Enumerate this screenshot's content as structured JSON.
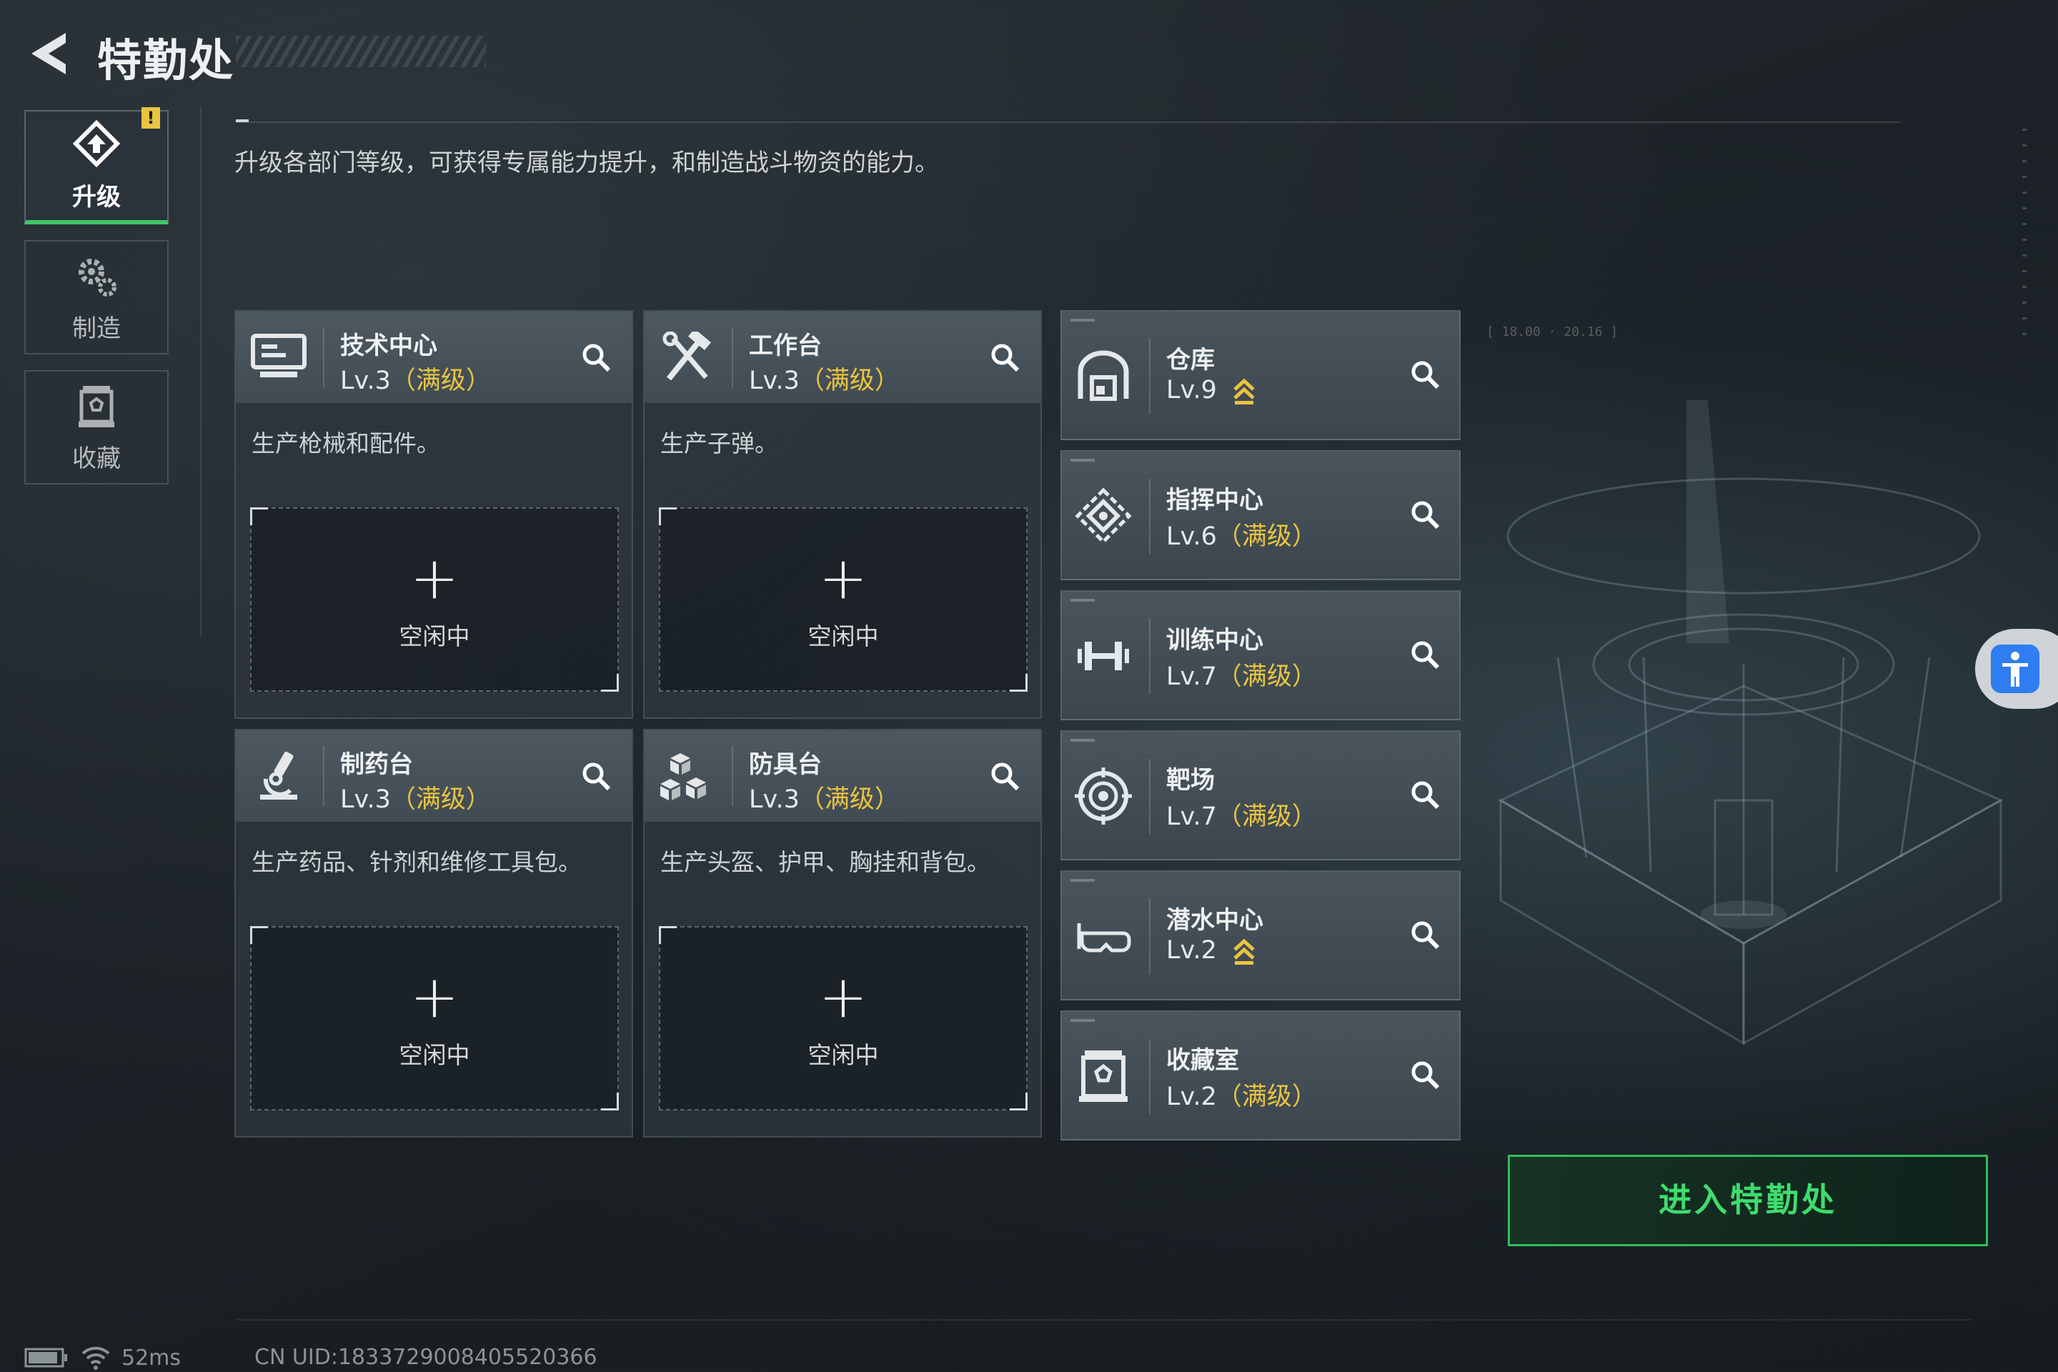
{
  "header": {
    "title": "特勤处",
    "description": "升级各部门等级，可获得专属能力提升，和制造战斗物资的能力。"
  },
  "sidebar": {
    "tabs": [
      {
        "label": "升级",
        "icon": "upgrade-icon",
        "active": true,
        "badge": "!"
      },
      {
        "label": "制造",
        "icon": "gear-craft-icon",
        "active": false
      },
      {
        "label": "收藏",
        "icon": "collection-icon",
        "active": false
      }
    ]
  },
  "production": [
    {
      "name": "技术中心",
      "level": "Lv.3",
      "max_label": "（满级）",
      "icon": "monitor-icon",
      "desc": "生产枪械和配件。",
      "slot_status": "空闲中",
      "plus": "+"
    },
    {
      "name": "工作台",
      "level": "Lv.3",
      "max_label": "（满级）",
      "icon": "tools-icon",
      "desc": "生产子弹。",
      "slot_status": "空闲中",
      "plus": "+"
    },
    {
      "name": "制药台",
      "level": "Lv.3",
      "max_label": "（满级）",
      "icon": "microscope-icon",
      "desc": "生产药品、针剂和维修工具包。",
      "slot_status": "空闲中",
      "plus": "+"
    },
    {
      "name": "防具台",
      "level": "Lv.3",
      "max_label": "（满级）",
      "icon": "armor-blocks-icon",
      "desc": "生产头盔、护甲、胸挂和背包。",
      "slot_status": "空闲中",
      "plus": "+"
    }
  ],
  "buildings": [
    {
      "name": "仓库",
      "level": "Lv.9",
      "max_label": "",
      "upgradable": true,
      "icon": "warehouse-icon"
    },
    {
      "name": "指挥中心",
      "level": "Lv.6",
      "max_label": "（满级）",
      "upgradable": false,
      "icon": "command-center-icon"
    },
    {
      "name": "训练中心",
      "level": "Lv.7",
      "max_label": "（满级）",
      "upgradable": false,
      "icon": "dumbbell-icon"
    },
    {
      "name": "靶场",
      "level": "Lv.7",
      "max_label": "（满级）",
      "upgradable": false,
      "icon": "target-icon"
    },
    {
      "name": "潜水中心",
      "level": "Lv.2",
      "max_label": "",
      "upgradable": true,
      "icon": "diving-mask-icon"
    },
    {
      "name": "收藏室",
      "level": "Lv.2",
      "max_label": "（满级）",
      "upgradable": false,
      "icon": "collection-room-icon"
    }
  ],
  "enter_button": "进入特勤处",
  "status": {
    "ping": "52ms",
    "uid": "CN UID:1833729008405520366"
  },
  "deco": {
    "coords": "[ 18.00 · 20.16 ]"
  },
  "colors": {
    "accent_green": "#41c46a",
    "max_level_yellow": "#e9c441",
    "badge_yellow": "#e9c441",
    "enter_text_green": "#3fdc6e"
  }
}
